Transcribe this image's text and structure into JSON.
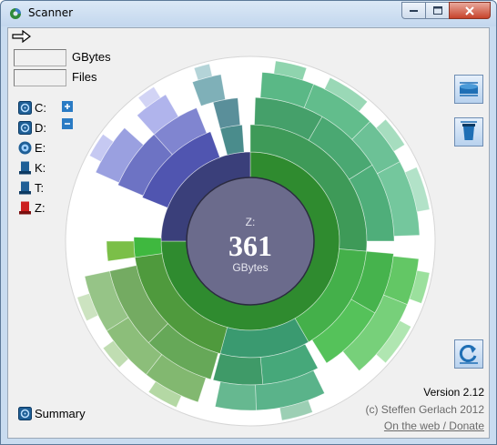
{
  "window": {
    "title": "Scanner"
  },
  "stats": {
    "gbytes_label": "GBytes",
    "files_label": "Files",
    "gbytes_value": "",
    "files_value": ""
  },
  "drives": [
    {
      "label": "C:",
      "icon": "hard-disk-icon",
      "color": "#1f5f96"
    },
    {
      "label": "D:",
      "icon": "hard-disk-icon",
      "color": "#1f5f96"
    },
    {
      "label": "E:",
      "icon": "optical-disc-icon",
      "color": "#1f5f96"
    },
    {
      "label": "K:",
      "icon": "usb-drive-icon",
      "color": "#1f5f96"
    },
    {
      "label": "T:",
      "icon": "usb-drive-icon",
      "color": "#1f5f96"
    },
    {
      "label": "Z:",
      "icon": "usb-drive-icon",
      "color": "#cc1f1f"
    }
  ],
  "center": {
    "drive": "Z:",
    "size": "361",
    "unit": "GBytes"
  },
  "footer": {
    "version": "Version 2.12",
    "copyright": "(c) Steffen Gerlach 2012",
    "link": "On the web / Donate"
  },
  "summary": {
    "label": "Summary"
  },
  "colors": {
    "accent": "#1f6fb5",
    "center_disc": "#6b6b8c",
    "ring1_green": "#2e8b2e",
    "ring1_blue": "#3a3f7a"
  }
}
